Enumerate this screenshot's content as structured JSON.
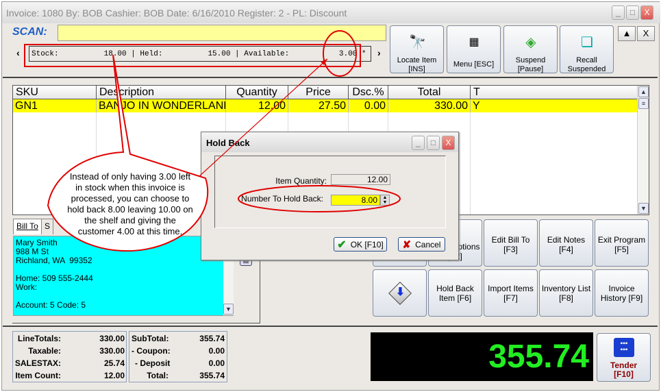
{
  "window": {
    "title": "Invoice: 1080  By: BOB  Cashier: BOB  Date:  6/16/2010  Register: 2 - PL: Discount",
    "minimize": "_",
    "maximize": "□",
    "close": "X"
  },
  "scan": {
    "label": "SCAN:",
    "value": ""
  },
  "stock_bar": {
    "left_arrow": "‹",
    "right_arrow": "›",
    "text": "Stock:          18.00 | Held:          15.00 | Available:           3.00 *"
  },
  "toolbar": [
    {
      "label": "Locate Item [INS]",
      "icon": "binoculars-icon"
    },
    {
      "label": "Menu [ESC]",
      "icon": "menu-grid-icon"
    },
    {
      "label": "Suspend [Pause]",
      "icon": "suspend-icon"
    },
    {
      "label": "Recall Suspended",
      "icon": "recall-icon"
    }
  ],
  "side_buttons": {
    "up": "▲",
    "close": "X"
  },
  "grid": {
    "columns": [
      "SKU",
      "Description",
      "Quantity",
      "Price",
      "Dsc.%",
      "Total",
      "T"
    ],
    "rows": [
      {
        "sku": "GN1",
        "description": "BANJO IN WONDERLAND",
        "quantity": "12.00",
        "price": "27.50",
        "discount": "0.00",
        "total": "330.00",
        "t": "Y"
      }
    ]
  },
  "bill_tabs": [
    "Bill To",
    "S"
  ],
  "bill_to": "Mary Smith\n988 M St\nRichland, WA  99352\n\nHome: 509 555-2444\nWork:\n\nAccount: 5 Code: 5",
  "function_buttons": [
    {
      "label": "More Options [F2]"
    },
    {
      "label": "Edit Bill To [F3]"
    },
    {
      "label": "Edit Notes [F4]"
    },
    {
      "label": "Exit Program [F5]"
    },
    {
      "label": "",
      "icon": "down-arrow-icon"
    },
    {
      "label": "Hold Back Item [F6]"
    },
    {
      "label": "Import Items [F7]"
    },
    {
      "label": "Inventory List [F8]"
    },
    {
      "label": "Invoice History [F9]"
    }
  ],
  "totals_left": [
    {
      "label": "LineTotals:",
      "value": "330.00"
    },
    {
      "label": "Taxable:",
      "value": "330.00"
    },
    {
      "label": "SALESTAX:",
      "value": "25.74"
    },
    {
      "label": "Item Count:",
      "value": "12.00"
    }
  ],
  "totals_right": [
    {
      "label": "SubTotal:",
      "value": "355.74"
    },
    {
      "label": "- Coupon:",
      "value": "0.00"
    },
    {
      "label": "- Deposit",
      "value": "0.00"
    },
    {
      "label": "Total:",
      "value": "355.74"
    }
  ],
  "display_total": "355.74",
  "tender": {
    "label": "Tender",
    "key": "[F10]"
  },
  "dialog": {
    "title": "Hold Back",
    "item_quantity_label": "Item Quantity:",
    "item_quantity": "12.00",
    "hold_back_label": "Number To Hold Back:",
    "hold_back_value": "8.00",
    "ok": "OK [F10]",
    "cancel": "Cancel"
  },
  "callout": "Instead of only having 3.00 left in stock when this invoice is processed, you can choose to hold back 8.00 leaving 10.00 on the shelf and giving the customer 4.00 at this time.",
  "colors": {
    "scan_blue": "#1e5fc8",
    "row_highlight": "#ffff00",
    "bill_to_bg": "#00ffff",
    "display_green": "#22ee22",
    "annotation_red": "#e00000"
  }
}
